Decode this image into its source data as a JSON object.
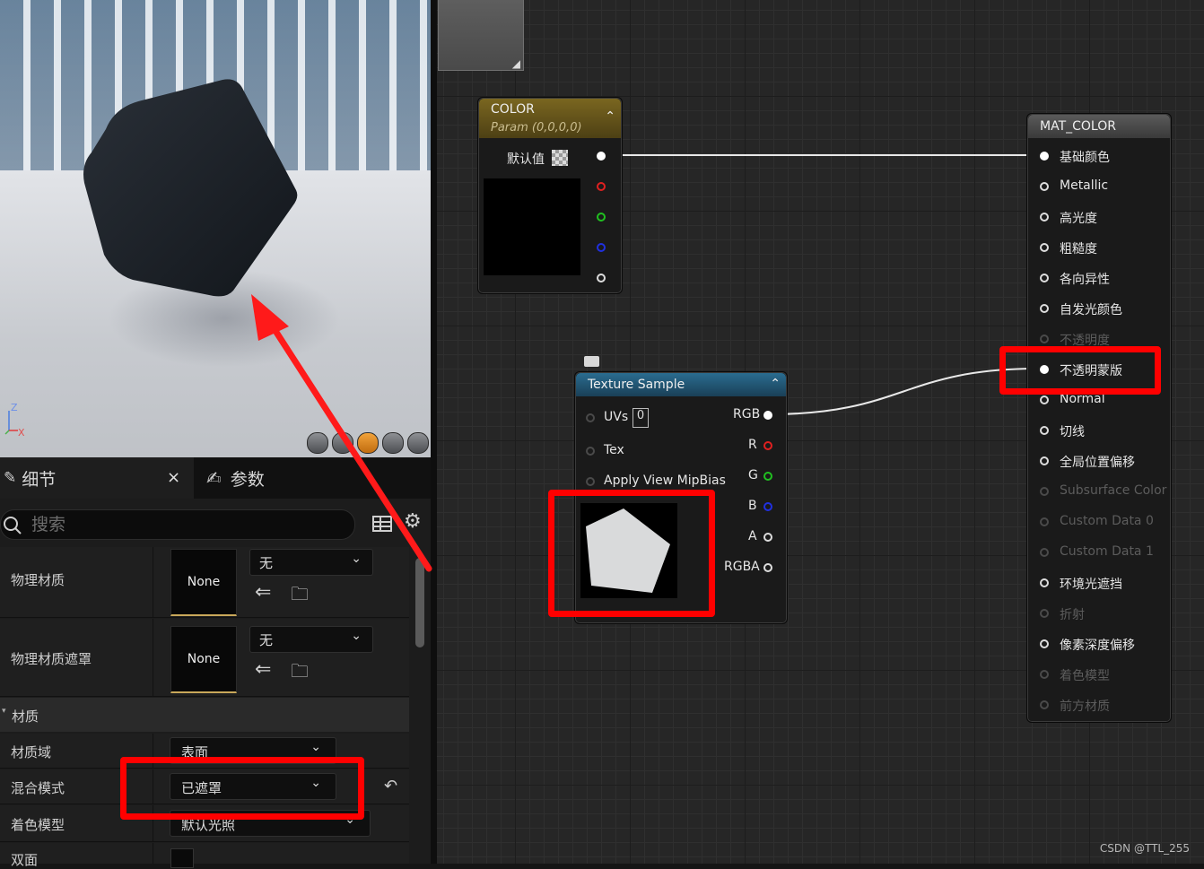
{
  "viewport": {
    "axis_z": "Z",
    "axis_x": "X",
    "view_mode_count": 5
  },
  "details_panel": {
    "tab_details": "细节",
    "tab_details_close": "×",
    "tab_params": "参数",
    "search_placeholder": "搜索",
    "rows": {
      "phys_material": {
        "label": "物理材质",
        "thumb": "None",
        "dropdown": "无"
      },
      "phys_material_mask": {
        "label": "物理材质遮罩",
        "thumb": "None",
        "dropdown": "无"
      },
      "section_material": "材质",
      "material_domain": {
        "label": "材质域",
        "value": "表面"
      },
      "blend_mode": {
        "label": "混合模式",
        "value": "已遮罩"
      },
      "shading_model": {
        "label": "着色模型",
        "value": "默认光照"
      },
      "two_sided": {
        "label": "双面"
      }
    },
    "chevron": "⌄"
  },
  "graph": {
    "color_node": {
      "title": "COLOR",
      "subtitle": "Param (0,0,0,0)",
      "default_label": "默认值",
      "header_color": "#6b5a1e"
    },
    "texture_node": {
      "title": "Texture Sample",
      "header_color": "#1f5a7a",
      "inputs": [
        "UVs",
        "Tex",
        "Apply View MipBias"
      ],
      "uv_value": "0",
      "outputs": [
        "RGB",
        "R",
        "G",
        "B",
        "A",
        "RGBA"
      ]
    },
    "mat_node": {
      "title": "MAT_COLOR",
      "pins": [
        {
          "label": "基础颜色",
          "state": "connected"
        },
        {
          "label": "Metallic",
          "state": "active"
        },
        {
          "label": "高光度",
          "state": "active"
        },
        {
          "label": "粗糙度",
          "state": "active"
        },
        {
          "label": "各向异性",
          "state": "active"
        },
        {
          "label": "自发光颜色",
          "state": "active"
        },
        {
          "label": "不透明度",
          "state": "disabled"
        },
        {
          "label": "不透明蒙版",
          "state": "connected"
        },
        {
          "label": "Normal",
          "state": "active"
        },
        {
          "label": "切线",
          "state": "active"
        },
        {
          "label": "全局位置偏移",
          "state": "active"
        },
        {
          "label": "Subsurface Color",
          "state": "disabled"
        },
        {
          "label": "Custom Data 0",
          "state": "disabled"
        },
        {
          "label": "Custom Data 1",
          "state": "disabled"
        },
        {
          "label": "环境光遮挡",
          "state": "active"
        },
        {
          "label": "折射",
          "state": "disabled"
        },
        {
          "label": "像素深度偏移",
          "state": "active"
        },
        {
          "label": "着色模型",
          "state": "disabled"
        },
        {
          "label": "前方材质",
          "state": "disabled"
        }
      ]
    }
  },
  "annotation_color": "#ff0000",
  "watermark": "CSDN @TTL_255"
}
